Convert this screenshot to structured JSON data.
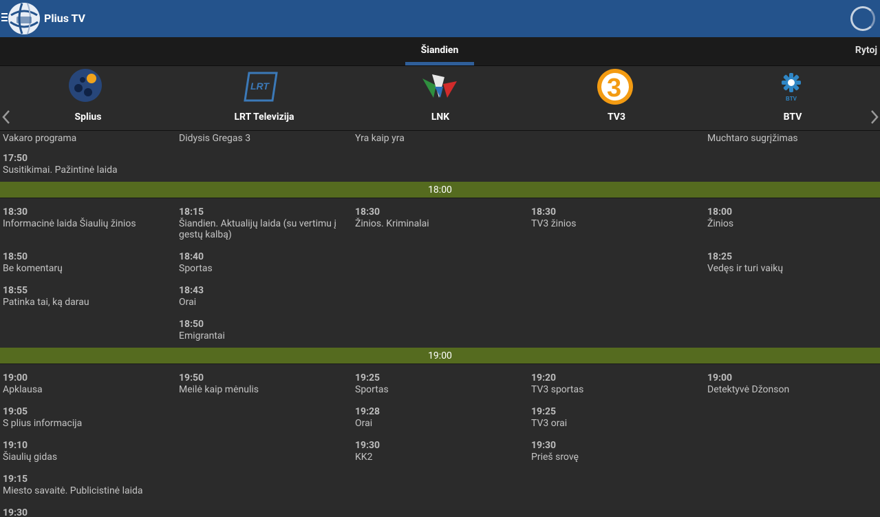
{
  "app": {
    "title": "Plius TV"
  },
  "icons": {
    "menu": "menu-icon",
    "logo": "globe-logo",
    "refresh": "loading-spinner-icon",
    "prev": "chevron-left-icon",
    "next": "chevron-right-icon"
  },
  "tabs": {
    "today": "Šiandien",
    "tomorrow": "Rytoj"
  },
  "channels": [
    {
      "name": "Splius"
    },
    {
      "name": "LRT Televizija"
    },
    {
      "name": "LNK"
    },
    {
      "name": "TV3"
    },
    {
      "name": "BTV"
    }
  ],
  "hours": {
    "h18": "18:00",
    "h19": "19:00"
  },
  "programs": {
    "before": {
      "splius": [
        {
          "time": "",
          "title": "Vakaro programa"
        },
        {
          "time": "17:50",
          "title": "Susitikimai. Pažintinė laida"
        }
      ],
      "lrt": [
        {
          "time": "",
          "title": "Didysis Gregas 3"
        }
      ],
      "lnk": [
        {
          "time": "",
          "title": "Yra kaip yra"
        }
      ],
      "tv3": [],
      "btv": [
        {
          "time": "",
          "title": "Muchtaro sugrįžimas"
        }
      ]
    },
    "h18": {
      "splius": [
        {
          "time": "18:30",
          "title": "Informacinė laida Šiaulių žinios"
        },
        {
          "time": "18:50",
          "title": "Be komentarų"
        },
        {
          "time": "18:55",
          "title": "Patinka tai, ką darau"
        }
      ],
      "lrt": [
        {
          "time": "18:15",
          "title": "Šiandien. Aktualijų laida (su vertimu į gestų kalbą)"
        },
        {
          "time": "18:40",
          "title": "Sportas"
        },
        {
          "time": "18:43",
          "title": "Orai"
        },
        {
          "time": "18:50",
          "title": "Emigrantai"
        }
      ],
      "lnk": [
        {
          "time": "18:30",
          "title": "Žinios. Kriminalai"
        }
      ],
      "tv3": [
        {
          "time": "18:30",
          "title": "TV3 žinios"
        }
      ],
      "btv": [
        {
          "time": "18:00",
          "title": "Žinios"
        },
        {
          "time": "18:25",
          "title": "Vedęs ir turi vaikų"
        }
      ]
    },
    "h19": {
      "splius": [
        {
          "time": "19:00",
          "title": "Apklausa"
        },
        {
          "time": "19:05",
          "title": "S plius informacija"
        },
        {
          "time": "19:10",
          "title": "Šiaulių gidas"
        },
        {
          "time": "19:15",
          "title": "Miesto savaitė. Publicistinė laida"
        },
        {
          "time": "19:30",
          "title": ""
        }
      ],
      "lrt": [
        {
          "time": "19:50",
          "title": "Meilė kaip mėnulis"
        }
      ],
      "lnk": [
        {
          "time": "19:25",
          "title": "Sportas"
        },
        {
          "time": "19:28",
          "title": "Orai"
        },
        {
          "time": "19:30",
          "title": "KK2"
        }
      ],
      "tv3": [
        {
          "time": "19:20",
          "title": "TV3 sportas"
        },
        {
          "time": "19:25",
          "title": "TV3 orai"
        },
        {
          "time": "19:30",
          "title": "Prieš srovę"
        }
      ],
      "btv": [
        {
          "time": "19:00",
          "title": "Detektyvė Džonson"
        }
      ]
    }
  },
  "colors": {
    "actionbar": "#24538c",
    "hourbar": "#556b1f",
    "background": "#2b2b2b",
    "tab_indicator": "#2f5f9a"
  }
}
